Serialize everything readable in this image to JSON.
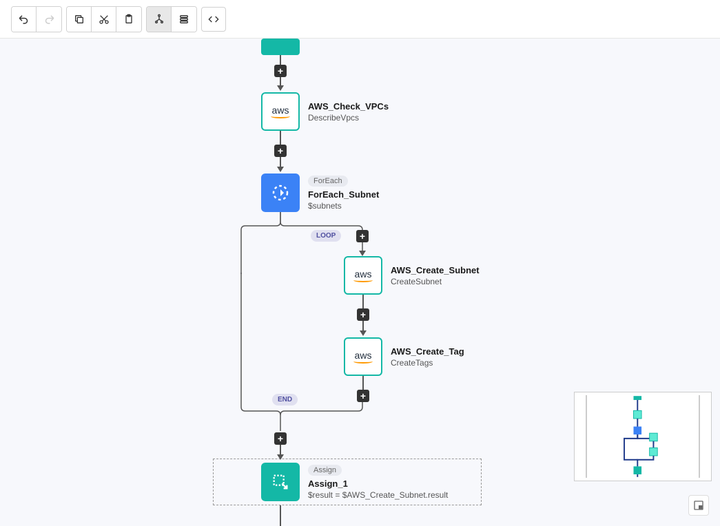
{
  "toolbar": {
    "undo": "↶",
    "redo": "↷",
    "copy": "copy",
    "cut": "cut",
    "paste": "paste",
    "tree": "tree",
    "list": "list",
    "code": "< >"
  },
  "nodes": {
    "check_vpcs": {
      "title": "AWS_Check_VPCs",
      "sub": "DescribeVpcs"
    },
    "foreach": {
      "pill": "ForEach",
      "title": "ForEach_Subnet",
      "sub": "$subnets"
    },
    "create_subnet": {
      "title": "AWS_Create_Subnet",
      "sub": "CreateSubnet"
    },
    "create_tag": {
      "title": "AWS_Create_Tag",
      "sub": "CreateTags"
    },
    "assign": {
      "pill": "Assign",
      "title": "Assign_1",
      "sub": "$result = $AWS_Create_Subnet.result"
    }
  },
  "badges": {
    "loop": "LOOP",
    "end": "END"
  }
}
